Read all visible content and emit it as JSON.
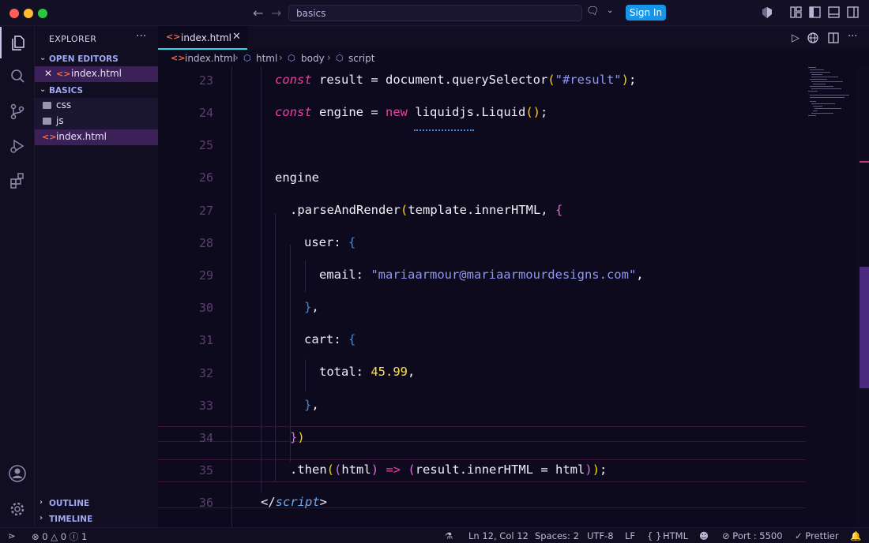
{
  "window": {
    "search_text": "basics",
    "sign_in_label": "Sign In"
  },
  "sidebar": {
    "title": "EXPLORER",
    "more_label": "···",
    "open_editors_label": "OPEN EDITORS",
    "open_editors": [
      {
        "name": "index.html",
        "icon": "html-file-icon"
      }
    ],
    "project_label": "BASICS",
    "files": [
      {
        "name": "css",
        "type": "folder"
      },
      {
        "name": "js",
        "type": "folder"
      },
      {
        "name": "index.html",
        "type": "html-file"
      }
    ],
    "outline_label": "OUTLINE",
    "timeline_label": "TIMELINE"
  },
  "editor": {
    "tab_label": "index.html",
    "breadcrumbs": [
      "index.html",
      "html",
      "body",
      "script"
    ],
    "line_numbers": [
      "23",
      "24",
      "25",
      "26",
      "27",
      "28",
      "29",
      "30",
      "31",
      "32",
      "33",
      "34",
      "35",
      "36"
    ],
    "code": {
      "l23": {
        "kw": "const",
        "a": " result = document.querySelector",
        "p1": "(",
        "s": "\"#result\"",
        "p2": ")",
        "end": ";"
      },
      "l24": {
        "kw": "const",
        "a": " engine = ",
        "new": "new",
        "b": " liquidjs.Liquid",
        "p": "()",
        "end": ";"
      },
      "l26": "engine",
      "l27": {
        "a": ".parseAndRender",
        "p1": "(",
        "b": "template.innerHTML, ",
        "p2": "{"
      },
      "l28": {
        "a": "user: ",
        "p": "{"
      },
      "l29": {
        "a": "email: ",
        "s": "\"mariaarmour@mariaarmourdesigns.com\"",
        "end": ","
      },
      "l30": {
        "p": "}",
        "end": ","
      },
      "l31": {
        "a": "cart: ",
        "p": "{"
      },
      "l32": {
        "a": "total: ",
        "n": "45.99",
        "end": ","
      },
      "l33": {
        "p": "}",
        "end": ","
      },
      "l34": {
        "p1": "}",
        "p2": ")"
      },
      "l35": {
        "a": ".then",
        "p1": "(",
        "p2": "(",
        "b": "html",
        "p3": ")",
        "arrow": " => ",
        "p4": "(",
        "c": "result.innerHTML = html",
        "p5": ")",
        "p6": ")",
        "end": ";"
      },
      "l36": {
        "open": "</",
        "tag": "script",
        "close": ">"
      }
    }
  },
  "status": {
    "errors": "0",
    "warnings": "0",
    "info": "1",
    "position": "Ln 12, Col 12",
    "spaces": "Spaces: 2",
    "encoding": "UTF-8",
    "eol": "LF",
    "language": "HTML",
    "port": "Port : 5500",
    "formatter": "Prettier"
  },
  "colors": {
    "accent_tab": "#27d8e8",
    "signin_bg": "#1596e8",
    "keyword": "#ee3fa2",
    "string": "#8f98f0",
    "number": "#f9e14c"
  }
}
